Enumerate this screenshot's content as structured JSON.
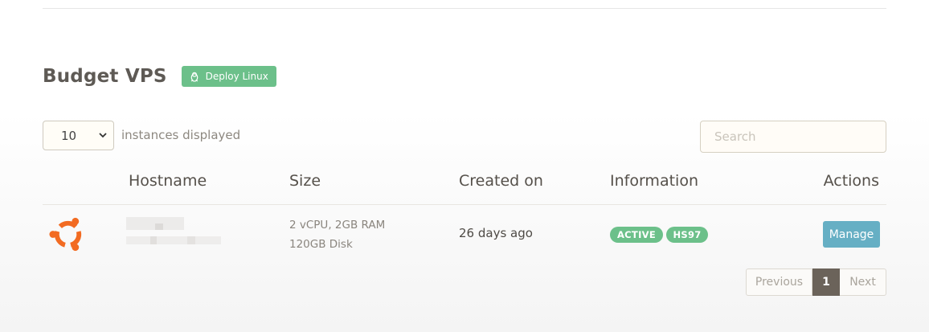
{
  "section": {
    "title": "Budget VPS",
    "deploy_label": "Deploy Linux"
  },
  "controls": {
    "length_value": "10",
    "length_label": "instances displayed",
    "search_placeholder": "Search"
  },
  "table": {
    "headers": [
      "Hostname",
      "Size",
      "Created on",
      "Information",
      "Actions"
    ],
    "rows": [
      {
        "os": "ubuntu-logo",
        "hostname": "",
        "size_line1": "2 vCPU, 2GB RAM",
        "size_line2": "120GB Disk",
        "created": "26 days ago",
        "status": "ACTIVE",
        "location": "HS97",
        "action": "Manage"
      }
    ]
  },
  "pagination": {
    "previous": "Previous",
    "current": "1",
    "next": "Next"
  },
  "colors": {
    "badge_green": "#6cc08a",
    "manage_blue": "#66afc4",
    "ubuntu_orange": "#f26b22"
  }
}
